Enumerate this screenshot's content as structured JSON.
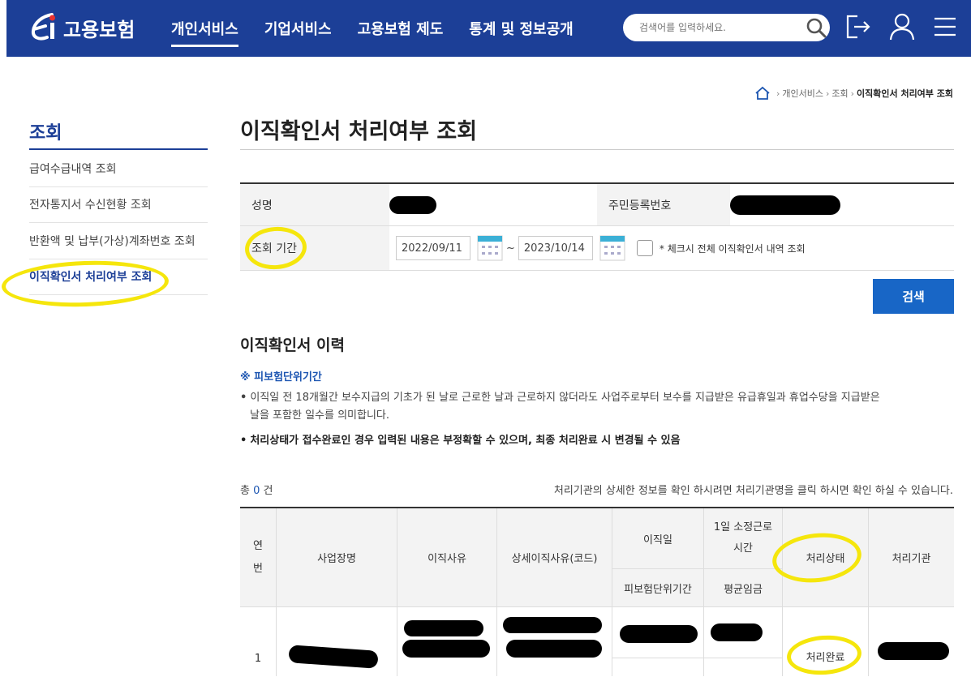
{
  "header": {
    "logo_text": "고용보험",
    "nav": [
      "개인서비스",
      "기업서비스",
      "고용보험 제도",
      "통계 및 정보공개"
    ],
    "search_placeholder": "검색어를 입력하세요."
  },
  "breadcrumb": [
    "개인서비스",
    "조회",
    "이직확인서 처리여부 조회"
  ],
  "sidebar": {
    "title": "조회",
    "items": [
      "급여수급내역 조회",
      "전자통지서 수신현황 조회",
      "반환액 및 납부(가상)계좌번호 조회",
      "이직확인서 처리여부 조회"
    ]
  },
  "page_title": "이직확인서 처리여부 조회",
  "form": {
    "name_label": "성명",
    "rrn_label": "주민등록번호",
    "period_label": "조회 기간",
    "date_from": "2022/09/11",
    "date_to": "2023/10/14",
    "tilde": "~",
    "checkbox_label": "* 체크시 전체 이직확인서 내역 조회"
  },
  "search_button": "검색",
  "history": {
    "title": "이직확인서 이력",
    "note_title": "※ 피보험단위기간",
    "note_line1": "이직일 전 18개월간 보수지급의 기초가 된 날로 근로한 날과 근로하지 않더라도 사업주로부터 보수를 지급받은 유급휴일과 휴업수당을 지급받은",
    "note_line2": "날을 포함한 일수를 의미합니다.",
    "note_bold": "처리상태가 접수완료인 경우 입력된 내용은 부정확할 수 있으며, 최종 처리완료 시 변경될 수 있음",
    "bullet": "•",
    "total_prefix": "총",
    "total_count": "0",
    "total_suffix": "건",
    "hint": "처리기관의 상세한 정보를 확인 하시려면 처리기관명을 클릭 하시면 확인 하실 수 있습니다."
  },
  "table": {
    "headers": {
      "no": "연번",
      "company": "사업장명",
      "reason": "이직사유",
      "reason_detail": "상세이직사유(코드)",
      "leave_date": "이직일",
      "insured_period": "피보험단위기간",
      "daily_hours": "1일 소정근로\n시간",
      "avg_wage": "평균임금",
      "status": "처리상태",
      "agency": "처리기관"
    },
    "rows": [
      {
        "no": "1",
        "status": "처리완료"
      }
    ]
  },
  "colors": {
    "brand": "#1c3f97",
    "button": "#1866c6",
    "highlight": "#f5e60c"
  }
}
